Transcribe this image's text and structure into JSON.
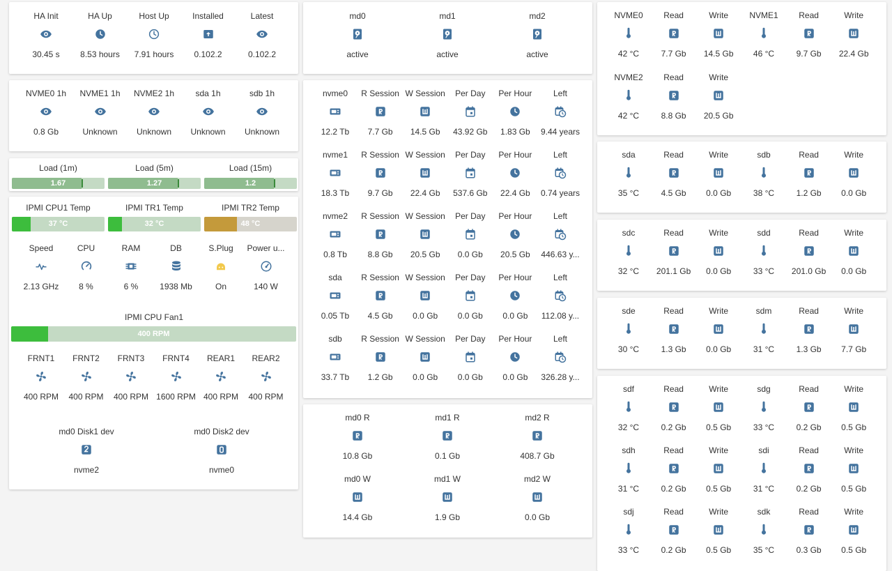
{
  "colors": {
    "icon": "#44739e",
    "bar_bg": "#c4dac4",
    "bar_green": "#3dbd3d",
    "bar_load": "#8fbc8f",
    "bar_warn": "#c49a3b",
    "bar_warn_bg": "#d6d4cc",
    "yellow_icon": "#f2c94c"
  },
  "card1": {
    "items": [
      {
        "label": "HA Init",
        "icon": "eye-icon",
        "value": "30.45 s"
      },
      {
        "label": "HA Up",
        "icon": "clock-icon",
        "value": "8.53 hours"
      },
      {
        "label": "Host Up",
        "icon": "clock-outline-icon",
        "value": "7.91 hours"
      },
      {
        "label": "Installed",
        "icon": "package-icon",
        "value": "0.102.2"
      },
      {
        "label": "Latest",
        "icon": "eye-icon",
        "value": "0.102.2"
      }
    ]
  },
  "card2": {
    "items": [
      {
        "label": "NVME0 1h",
        "icon": "eye-icon",
        "value": "0.8 Gb"
      },
      {
        "label": "NVME1 1h",
        "icon": "eye-icon",
        "value": "Unknown"
      },
      {
        "label": "NVME2 1h",
        "icon": "eye-icon",
        "value": "Unknown"
      },
      {
        "label": "sda 1h",
        "icon": "eye-icon",
        "value": "Unknown"
      },
      {
        "label": "sdb 1h",
        "icon": "eye-icon",
        "value": "Unknown"
      }
    ]
  },
  "load": [
    {
      "label": "Load (1m)",
      "value": "1.67",
      "fill": 0.75
    },
    {
      "label": "Load (5m)",
      "value": "1.27",
      "fill": 0.75
    },
    {
      "label": "Load (15m)",
      "value": "1.2",
      "fill": 0.75
    }
  ],
  "temps": [
    {
      "label": "IPMI CPU1 Temp",
      "value": "37 °C",
      "fill": 0.2,
      "warn": false
    },
    {
      "label": "IPMI TR1 Temp",
      "value": "32 °C",
      "fill": 0.15,
      "warn": false
    },
    {
      "label": "IPMI TR2 Temp",
      "value": "48 °C",
      "fill": 0.35,
      "warn": true
    }
  ],
  "sys": [
    {
      "label": "Speed",
      "icon": "pulse-icon",
      "value": "2.13 GHz"
    },
    {
      "label": "CPU",
      "icon": "gauge-icon",
      "value": "8 %"
    },
    {
      "label": "RAM",
      "icon": "memory-icon",
      "value": "6 %"
    },
    {
      "label": "DB",
      "icon": "database-icon",
      "value": "1938 Mb"
    },
    {
      "label": "S.Plug",
      "icon": "plug-icon",
      "value": "On"
    },
    {
      "label": "Power u...",
      "icon": "speedometer-icon",
      "value": "140 W"
    }
  ],
  "fan1": {
    "label": "IPMI CPU Fan1",
    "value": "400 RPM",
    "fill": 0.13
  },
  "fans": [
    {
      "label": "FRNT1",
      "icon": "fan-icon",
      "value": "400 RPM"
    },
    {
      "label": "FRNT2",
      "icon": "fan-icon",
      "value": "400 RPM"
    },
    {
      "label": "FRNT3",
      "icon": "fan-icon",
      "value": "400 RPM"
    },
    {
      "label": "FRNT4",
      "icon": "fan-icon",
      "value": "1600 RPM"
    },
    {
      "label": "REAR1",
      "icon": "fan-icon",
      "value": "400 RPM"
    },
    {
      "label": "REAR2",
      "icon": "fan-icon",
      "value": "400 RPM"
    }
  ],
  "mddev": [
    {
      "label": "md0 Disk1 dev",
      "icon": "numeric-2-icon",
      "value": "nvme2"
    },
    {
      "label": "md0 Disk2 dev",
      "icon": "numeric-0-icon",
      "value": "nvme0"
    }
  ],
  "raid": [
    {
      "label": "md0",
      "icon": "harddisk-icon",
      "value": "active"
    },
    {
      "label": "md1",
      "icon": "harddisk-icon",
      "value": "active"
    },
    {
      "label": "md2",
      "icon": "harddisk-icon",
      "value": "active"
    }
  ],
  "disks": [
    {
      "name": "nvme0",
      "total": "12.2 Tb",
      "r": "7.7 Gb",
      "w": "14.5 Gb",
      "day": "43.92 Gb",
      "hour": "1.83 Gb",
      "left": "9.44 years"
    },
    {
      "name": "nvme1",
      "total": "18.3 Tb",
      "r": "9.7 Gb",
      "w": "22.4 Gb",
      "day": "537.6 Gb",
      "hour": "22.4 Gb",
      "left": "0.74 years"
    },
    {
      "name": "nvme2",
      "total": "0.8 Tb",
      "r": "8.8 Gb",
      "w": "20.5 Gb",
      "day": "0.0 Gb",
      "hour": "20.5 Gb",
      "left": "446.63 y..."
    },
    {
      "name": "sda",
      "total": "0.05 Tb",
      "r": "4.5 Gb",
      "w": "0.0 Gb",
      "day": "0.0 Gb",
      "hour": "0.0 Gb",
      "left": "112.08 y..."
    },
    {
      "name": "sdb",
      "total": "33.7 Tb",
      "r": "1.2 Gb",
      "w": "0.0 Gb",
      "day": "0.0 Gb",
      "hour": "0.0 Gb",
      "left": "326.28 y..."
    }
  ],
  "disk_headers": {
    "r": "R Session",
    "w": "W Session",
    "day": "Per Day",
    "hour": "Per Hour",
    "left": "Left"
  },
  "mdrw": [
    {
      "label": "md0 R",
      "icon": "r-icon",
      "value": "10.8 Gb"
    },
    {
      "label": "md1 R",
      "icon": "r-icon",
      "value": "0.1 Gb"
    },
    {
      "label": "md2 R",
      "icon": "r-icon",
      "value": "408.7 Gb"
    },
    {
      "label": "md0 W",
      "icon": "w-icon",
      "value": "14.4 Gb"
    },
    {
      "label": "md1 W",
      "icon": "w-icon",
      "value": "1.9 Gb"
    },
    {
      "label": "md2 W",
      "icon": "w-icon",
      "value": "0.0 Gb"
    }
  ],
  "rw_headers": {
    "read": "Read",
    "write": "Write"
  },
  "nvme_temps": [
    {
      "name": "NVME0",
      "temp": "42 °C",
      "read": "7.7 Gb",
      "write": "14.5 Gb"
    },
    {
      "name": "NVME1",
      "temp": "46 °C",
      "read": "9.7 Gb",
      "write": "22.4 Gb"
    },
    {
      "name": "NVME2",
      "temp": "42 °C",
      "read": "8.8 Gb",
      "write": "20.5 Gb"
    }
  ],
  "hdd_cards": [
    [
      {
        "name": "sda",
        "temp": "35 °C",
        "read": "4.5 Gb",
        "write": "0.0 Gb"
      },
      {
        "name": "sdb",
        "temp": "38 °C",
        "read": "1.2 Gb",
        "write": "0.0 Gb"
      }
    ],
    [
      {
        "name": "sdc",
        "temp": "32 °C",
        "read": "201.1 Gb",
        "write": "0.0 Gb"
      },
      {
        "name": "sdd",
        "temp": "33 °C",
        "read": "201.0 Gb",
        "write": "0.0 Gb"
      }
    ],
    [
      {
        "name": "sde",
        "temp": "30 °C",
        "read": "1.3 Gb",
        "write": "0.0 Gb"
      },
      {
        "name": "sdm",
        "temp": "31 °C",
        "read": "1.3 Gb",
        "write": "7.7 Gb"
      }
    ]
  ],
  "last_card": [
    {
      "name": "sdf",
      "temp": "32 °C",
      "read": "0.2 Gb",
      "write": "0.5 Gb"
    },
    {
      "name": "sdg",
      "temp": "33 °C",
      "read": "0.2 Gb",
      "write": "0.5 Gb"
    },
    {
      "name": "sdh",
      "temp": "31 °C",
      "read": "0.2 Gb",
      "write": "0.5 Gb"
    },
    {
      "name": "sdi",
      "temp": "31 °C",
      "read": "0.2 Gb",
      "write": "0.5 Gb"
    },
    {
      "name": "sdj",
      "temp": "33 °C",
      "read": "0.2 Gb",
      "write": "0.5 Gb"
    },
    {
      "name": "sdk",
      "temp": "35 °C",
      "read": "0.3 Gb",
      "write": "0.5 Gb"
    }
  ]
}
